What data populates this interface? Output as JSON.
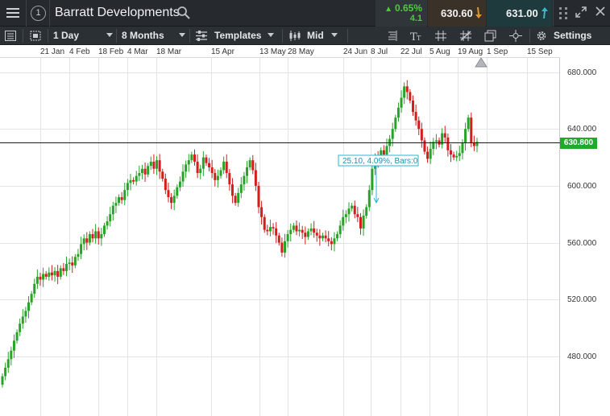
{
  "instrument": {
    "name": "Barratt Developments",
    "badge_number": "1"
  },
  "quote": {
    "change_percent": "0.65%",
    "change_abs": "4.1",
    "sell_price": "630.60",
    "buy_price": "631.00",
    "up_color": "#4ccc3b",
    "sell_arrow_color": "#e0962a",
    "buy_arrow_color": "#3fb6c9"
  },
  "toolbar": {
    "interval": "1 Day",
    "period": "8 Months",
    "templates_label": "Templates",
    "price_type": "Mid",
    "settings_label": "Settings"
  },
  "chart_data": {
    "type": "candlestick",
    "title": "",
    "x_tick_labels": [
      "21 Jan",
      "4 Feb",
      "18 Feb",
      "4 Mar",
      "18 Mar",
      "15 Apr",
      "13 May",
      "28 May",
      "24 Jun",
      "8 Jul",
      "22 Jul",
      "5 Aug",
      "19 Aug",
      "1 Sep",
      "15 Sep"
    ],
    "y_tick_labels": [
      "680.000",
      "640.000",
      "600.000",
      "560.000",
      "520.000",
      "480.000"
    ],
    "y_ticks": [
      680,
      640,
      600,
      560,
      520,
      480
    ],
    "ylim": [
      438,
      690
    ],
    "last_price": 630.8,
    "last_price_label": "630.800",
    "up_color": "#27a427",
    "down_color": "#d41d1d",
    "grid": true,
    "series": [
      {
        "name": "",
        "close": [
          466,
          472,
          478,
          484,
          491,
          497,
          503,
          508,
          512,
          518,
          524,
          531,
          536,
          534,
          538,
          536,
          539,
          537,
          540,
          536,
          542,
          540,
          545,
          546,
          544,
          550,
          552,
          559,
          563,
          560,
          566,
          563,
          568,
          563,
          566,
          572,
          575,
          580,
          586,
          588,
          592,
          590,
          597,
          602,
          604,
          603,
          607,
          609,
          612,
          608,
          614,
          617,
          612,
          618,
          610,
          605,
          597,
          592,
          588,
          593,
          599,
          603,
          610,
          615,
          618,
          622,
          617,
          609,
          612,
          620,
          616,
          613,
          609,
          604,
          607,
          611,
          617,
          609,
          601,
          593,
          588,
          595,
          601,
          607,
          613,
          618,
          611,
          600,
          585,
          578,
          569,
          568,
          571,
          570,
          565,
          560,
          553,
          561,
          566,
          569,
          572,
          568,
          569,
          567,
          564,
          568,
          570,
          567,
          565,
          563,
          565,
          563,
          561,
          559,
          563,
          566,
          572,
          578,
          580,
          584,
          586,
          580,
          578,
          570,
          579,
          585,
          597,
          612,
          620,
          618,
          625,
          622,
          628,
          633,
          640,
          648,
          655,
          662,
          670,
          666,
          660,
          652,
          646,
          640,
          632,
          624,
          619,
          626,
          631,
          632,
          629,
          637,
          634,
          625,
          622,
          620,
          621,
          623,
          630,
          640,
          648,
          630,
          628,
          631
        ]
      }
    ]
  },
  "measure_annotation": {
    "text": "25.10, 4.09%, Bars:0"
  }
}
